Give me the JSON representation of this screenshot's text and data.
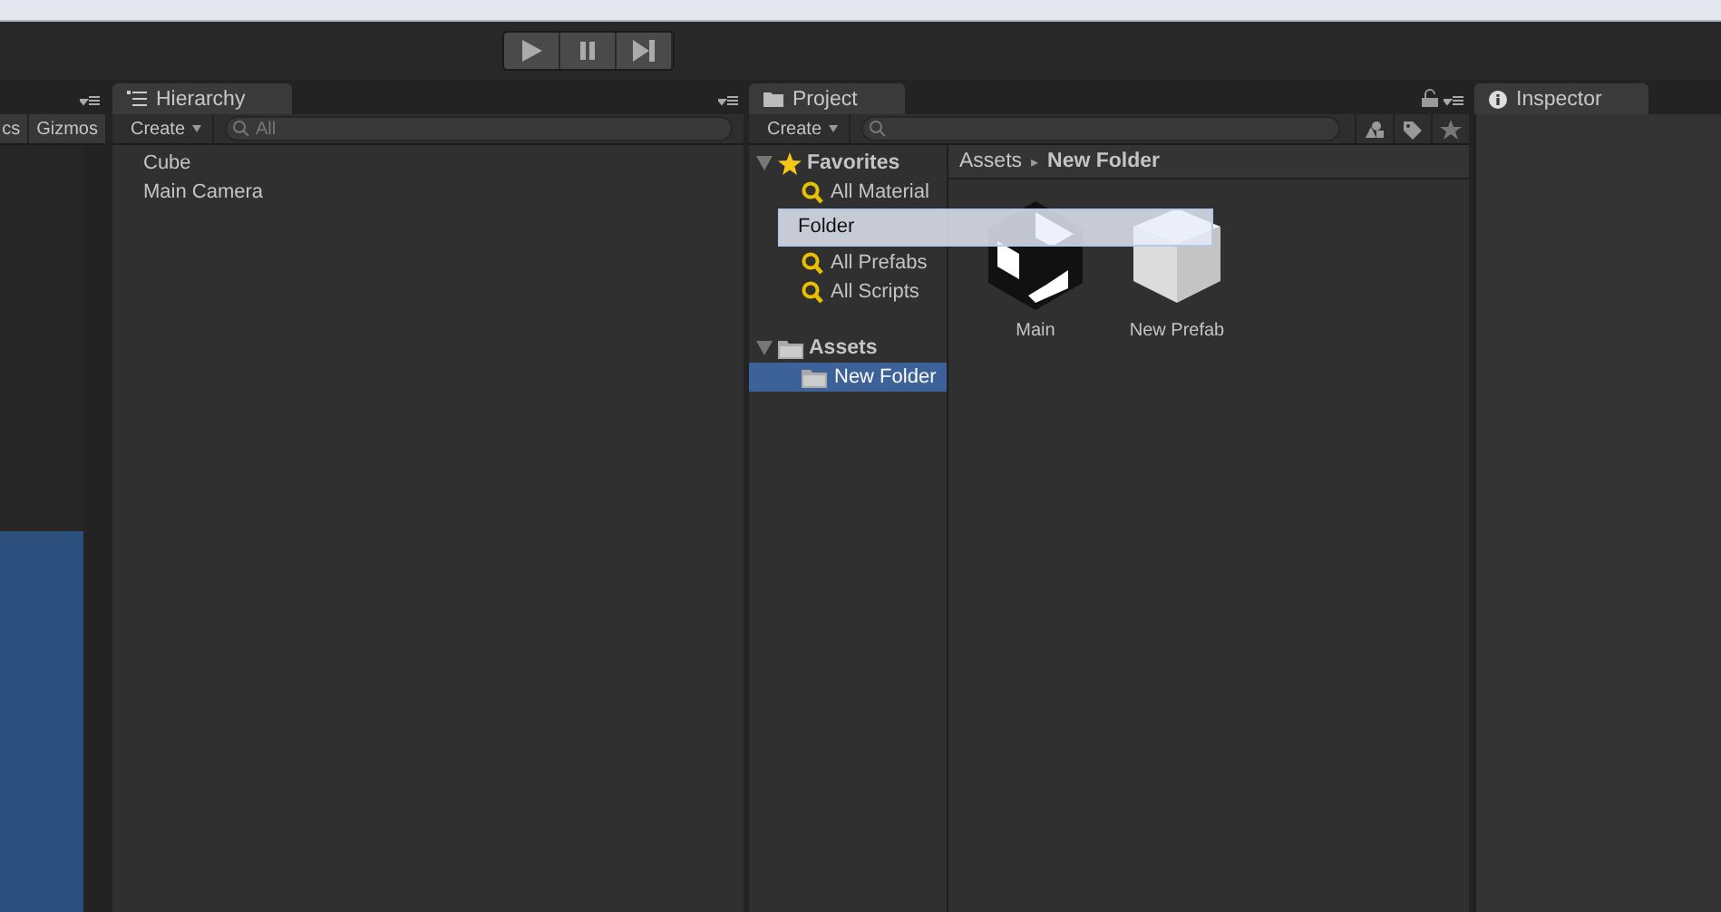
{
  "scene": {
    "toolbar_items": [
      "cs",
      "Gizmos"
    ]
  },
  "hierarchy": {
    "tab": "Hierarchy",
    "create": "Create",
    "search_placeholder": "All",
    "items": [
      "Cube",
      "Main Camera"
    ]
  },
  "project": {
    "tab": "Project",
    "create": "Create",
    "favorites": {
      "label": "Favorites",
      "expanded": true,
      "items": [
        {
          "kind": "search",
          "label": "All Material"
        },
        {
          "kind": "drag-ghost",
          "label": "Folder"
        },
        {
          "kind": "search",
          "label": "All Prefabs"
        },
        {
          "kind": "search",
          "label": "All Scripts"
        }
      ]
    },
    "assets": {
      "label": "Assets",
      "expanded": true,
      "children": [
        {
          "label": "New Folder",
          "selected": true
        }
      ]
    },
    "breadcrumb": [
      "Assets",
      "New Folder"
    ],
    "breadcrumb_separator": "▸",
    "items": [
      {
        "label": "Main",
        "kind": "unity-logo"
      },
      {
        "label": "New Prefab",
        "kind": "prefab"
      }
    ]
  },
  "inspector": {
    "tab": "Inspector"
  }
}
